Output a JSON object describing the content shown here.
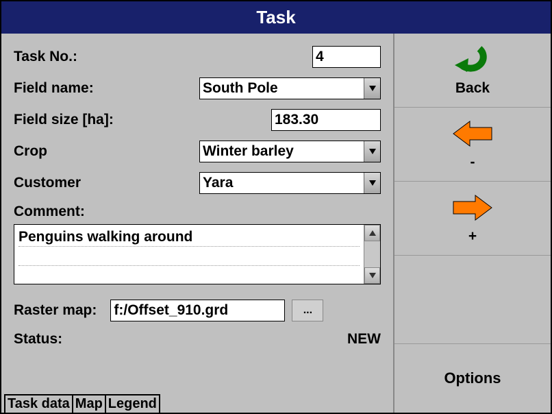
{
  "window": {
    "title": "Task"
  },
  "form": {
    "task_no_label": "Task No.:",
    "task_no_value": "4",
    "field_name_label": "Field name:",
    "field_name_value": "South Pole",
    "field_size_label": "Field size [ha]:",
    "field_size_value": "183.30",
    "crop_label": "Crop",
    "crop_value": "Winter barley",
    "customer_label": "Customer",
    "customer_value": "Yara",
    "comment_label": "Comment:",
    "comment_value": "Penguins walking around",
    "raster_label": "Raster map:",
    "raster_value": "f:/Offset_910.grd",
    "browse_label": "...",
    "status_label": "Status:",
    "status_value": "NEW"
  },
  "tabs": {
    "task_data": "Task data",
    "map": "Map",
    "legend": "Legend"
  },
  "sidebar": {
    "back": "Back",
    "minus": "-",
    "plus": "+",
    "options": "Options"
  },
  "icons": {
    "back": "back-arrow-icon",
    "left": "arrow-left-icon",
    "right": "arrow-right-icon",
    "dropdown": "chevron-down-icon",
    "scroll_up": "scroll-up-icon",
    "scroll_down": "scroll-down-icon"
  }
}
